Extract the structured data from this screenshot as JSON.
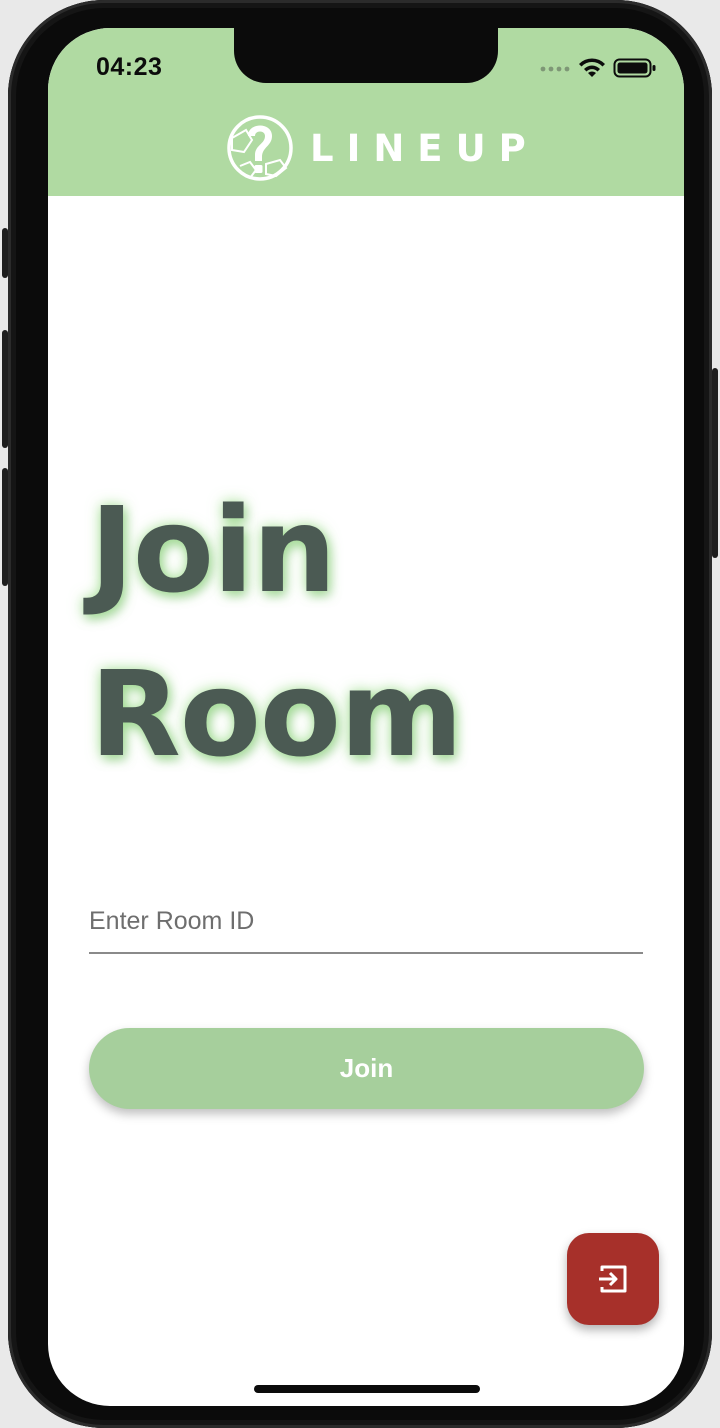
{
  "status_bar": {
    "time": "04:23",
    "icons": [
      "signal-dots-icon",
      "wifi-icon",
      "battery-icon"
    ]
  },
  "header": {
    "logo_icon": "soccer-ball-question-mark-logo",
    "brand_name": "LINEUP",
    "background_color": "#b0daa2"
  },
  "page": {
    "title_line1": "Join",
    "title_line2": "Room",
    "title_color": "#4b5a53"
  },
  "form": {
    "room_id_placeholder": "Enter Room ID",
    "room_id_value": "",
    "join_button_label": "Join",
    "join_button_color": "#a6cf9c"
  },
  "fab": {
    "icon": "exit-arrow-icon",
    "color": "#a7302a"
  }
}
